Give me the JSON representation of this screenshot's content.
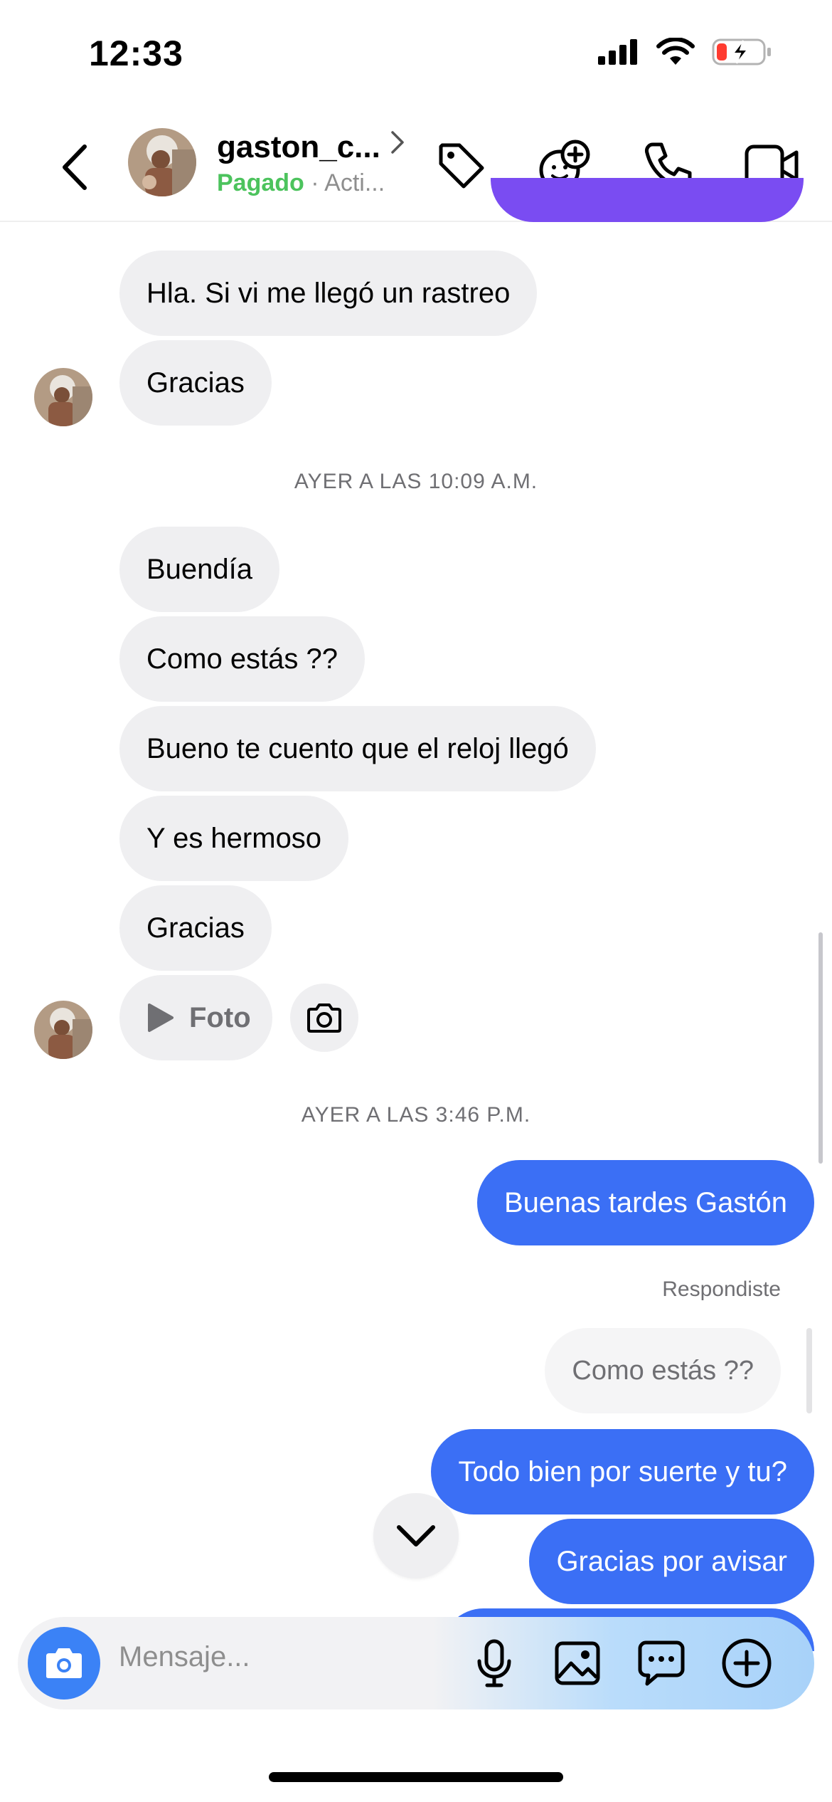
{
  "status_bar": {
    "time": "12:33"
  },
  "header": {
    "contact_name": "gaston_c...",
    "status_paid": "Pagado",
    "status_separator": "·",
    "status_activity": "Acti..."
  },
  "messages": {
    "m1": "Hla. Si vi me llegó un rastreo",
    "m2": "Gracias",
    "ts1": "AYER A LAS 10:09 A.M.",
    "m3": "Buendía",
    "m4": "Como estás ??",
    "m5": "Bueno te cuento que el reloj llegó",
    "m6": "Y es hermoso",
    "m7": "Gracias",
    "m8_photo": "Foto",
    "ts2": "AYER A LAS 3:46 P.M.",
    "o1": "Buenas tardes Gastón",
    "reply_label": "Respondiste",
    "reply_quote": "Como estás ??",
    "o2": "Todo bien por suerte y tu?",
    "o3": "Gracias por avisar"
  },
  "composer": {
    "placeholder": "Mensaje..."
  },
  "colors": {
    "outgoing": "#3b6ff5",
    "incoming": "#efeff1",
    "paid": "#4cc35d"
  },
  "icons": [
    "back-icon",
    "chevron-right-icon",
    "tag-icon",
    "sticker-add-icon",
    "phone-icon",
    "video-icon",
    "play-icon",
    "camera-icon",
    "chevron-down-icon",
    "microphone-icon",
    "gallery-icon",
    "message-options-icon",
    "add-icon"
  ]
}
